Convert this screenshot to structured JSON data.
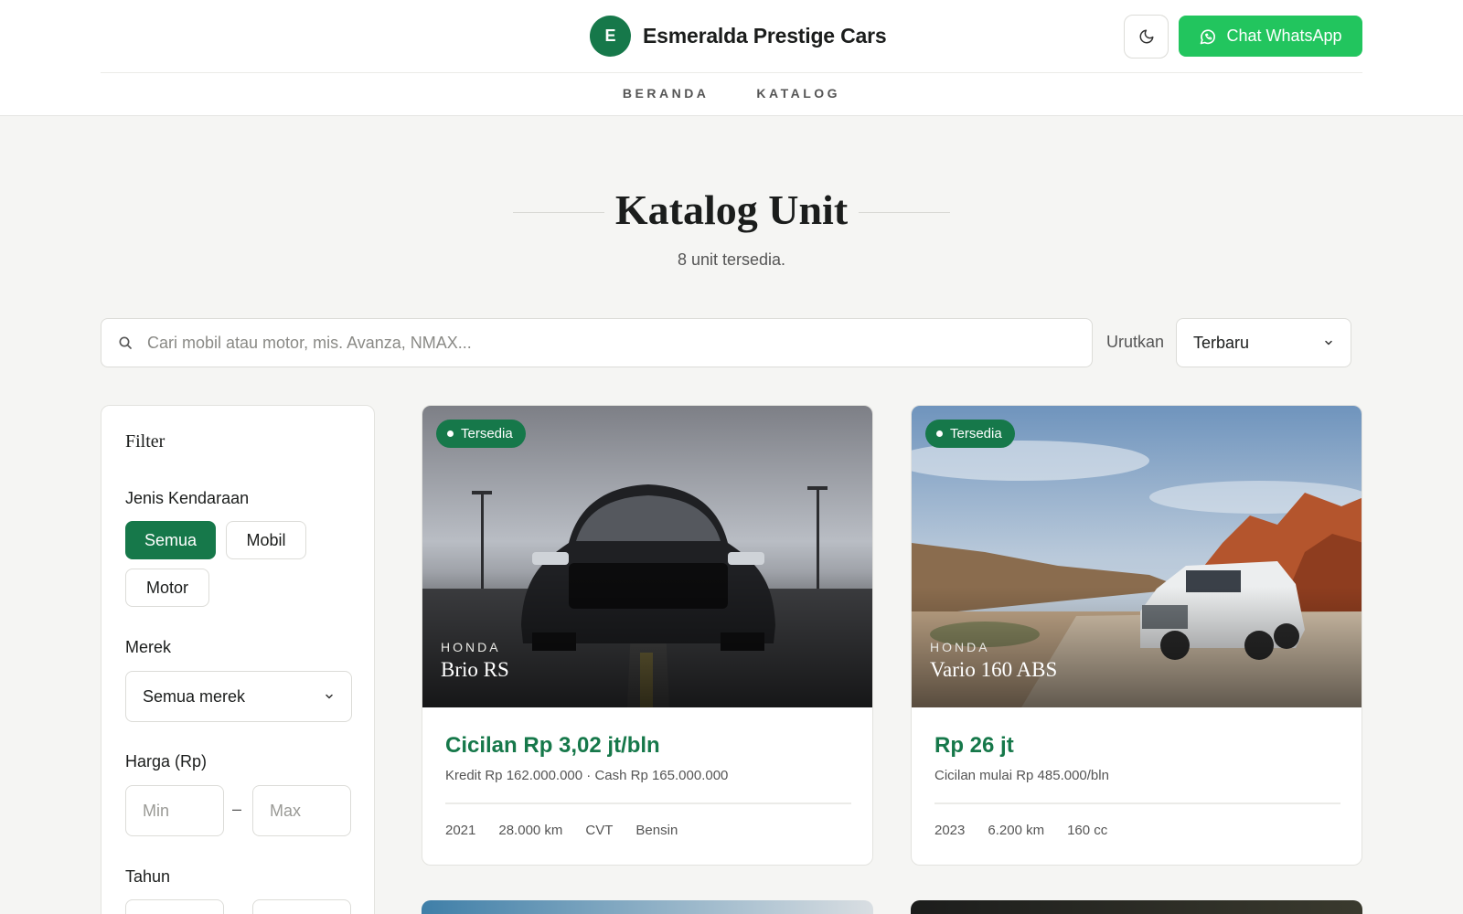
{
  "header": {
    "logo_letter": "E",
    "brand_name": "Esmeralda Prestige Cars",
    "theme_toggle_icon": "moon-icon",
    "whatsapp_label": "Chat WhatsApp",
    "whatsapp_icon": "whatsapp-icon"
  },
  "nav": {
    "items": [
      "BERANDA",
      "KATALOG"
    ]
  },
  "page": {
    "title": "Katalog Unit",
    "subtitle": "8 unit tersedia."
  },
  "search": {
    "placeholder": "Cari mobil atau motor, mis. Avanza, NMAX...",
    "value": ""
  },
  "sort": {
    "label": "Urutkan",
    "selected": "Terbaru"
  },
  "filter": {
    "title": "Filter",
    "vehicle_type": {
      "label": "Jenis Kendaraan",
      "options": [
        "Semua",
        "Mobil",
        "Motor"
      ],
      "selected": "Semua"
    },
    "brand": {
      "label": "Merek",
      "selected": "Semua merek"
    },
    "price": {
      "label": "Harga (Rp)",
      "min_placeholder": "Min",
      "max_placeholder": "Max",
      "separator": "–"
    },
    "year": {
      "label": "Tahun"
    }
  },
  "cards": [
    {
      "status": "Tersedia",
      "brand": "HONDA",
      "model": "Brio RS",
      "price": "Cicilan Rp 3,02 jt/bln",
      "sub": "Kredit Rp 162.000.000 · Cash Rp 165.000.000",
      "specs": [
        "2021",
        "28.000 km",
        "CVT",
        "Bensin"
      ]
    },
    {
      "status": "Tersedia",
      "brand": "HONDA",
      "model": "Vario 160 ABS",
      "price": "Rp 26 jt",
      "sub": "Cicilan mulai Rp 485.000/bln",
      "specs": [
        "2023",
        "6.200 km",
        "160 cc"
      ]
    }
  ],
  "colors": {
    "primary": "#16784a",
    "whatsapp": "#22c55e",
    "background": "#f5f5f3"
  }
}
